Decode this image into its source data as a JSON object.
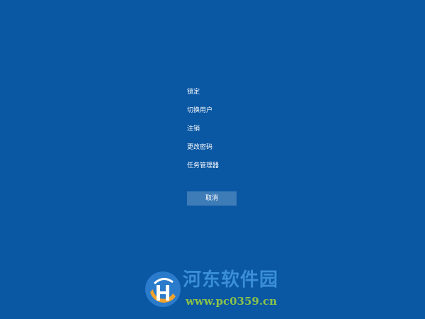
{
  "menu": {
    "items": [
      {
        "label": "锁定"
      },
      {
        "label": "切换用户"
      },
      {
        "label": "注销"
      },
      {
        "label": "更改密码"
      },
      {
        "label": "任务管理器"
      }
    ]
  },
  "cancel": {
    "label": "取消"
  },
  "watermark": {
    "title": "河东软件园",
    "url": "www.pc0359.cn"
  },
  "colors": {
    "background": "#0a57a4",
    "button": "#3e7cb8",
    "text": "#ffffff"
  }
}
